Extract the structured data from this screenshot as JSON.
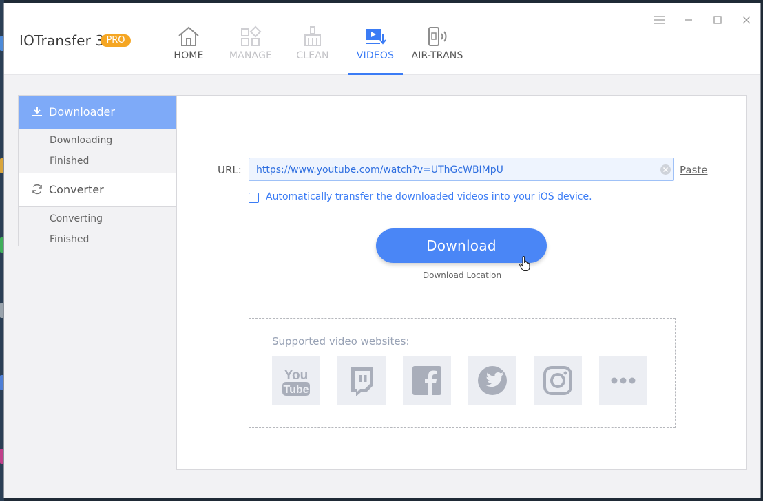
{
  "app": {
    "title": "IOTransfer 3",
    "badge": "PRO",
    "accent": "#3b7cf5",
    "badge_color": "#f5a623"
  },
  "nav": {
    "tabs": [
      {
        "label": "HOME",
        "icon": "home-icon",
        "state": "normal"
      },
      {
        "label": "MANAGE",
        "icon": "manage-icon",
        "state": "disabled"
      },
      {
        "label": "CLEAN",
        "icon": "clean-icon",
        "state": "disabled"
      },
      {
        "label": "VIDEOS",
        "icon": "videos-icon",
        "state": "active"
      },
      {
        "label": "AIR-TRANS",
        "icon": "air-trans-icon",
        "state": "normal"
      }
    ]
  },
  "window_controls": [
    "menu-icon",
    "minimize-icon",
    "maximize-icon",
    "close-icon"
  ],
  "sidebar": {
    "downloader": {
      "label": "Downloader",
      "icon": "download-icon",
      "active": true
    },
    "downloader_items": [
      "Downloading",
      "Finished"
    ],
    "converter": {
      "label": "Converter",
      "icon": "sync-icon"
    },
    "converter_items": [
      "Converting",
      "Finished"
    ]
  },
  "downloader": {
    "url_label": "URL:",
    "url_value": "https://www.youtube.com/watch?v=UThGcWBIMpU",
    "paste_label": "Paste",
    "auto_transfer_label": "Automatically transfer the downloaded videos into your iOS device.",
    "auto_transfer_checked": false,
    "download_button": "Download",
    "download_location": "Download Location"
  },
  "supported": {
    "title": "Supported video websites:",
    "sites": [
      "youtube-icon",
      "twitch-icon",
      "facebook-icon",
      "twitter-icon",
      "instagram-icon",
      "more-icon"
    ]
  }
}
